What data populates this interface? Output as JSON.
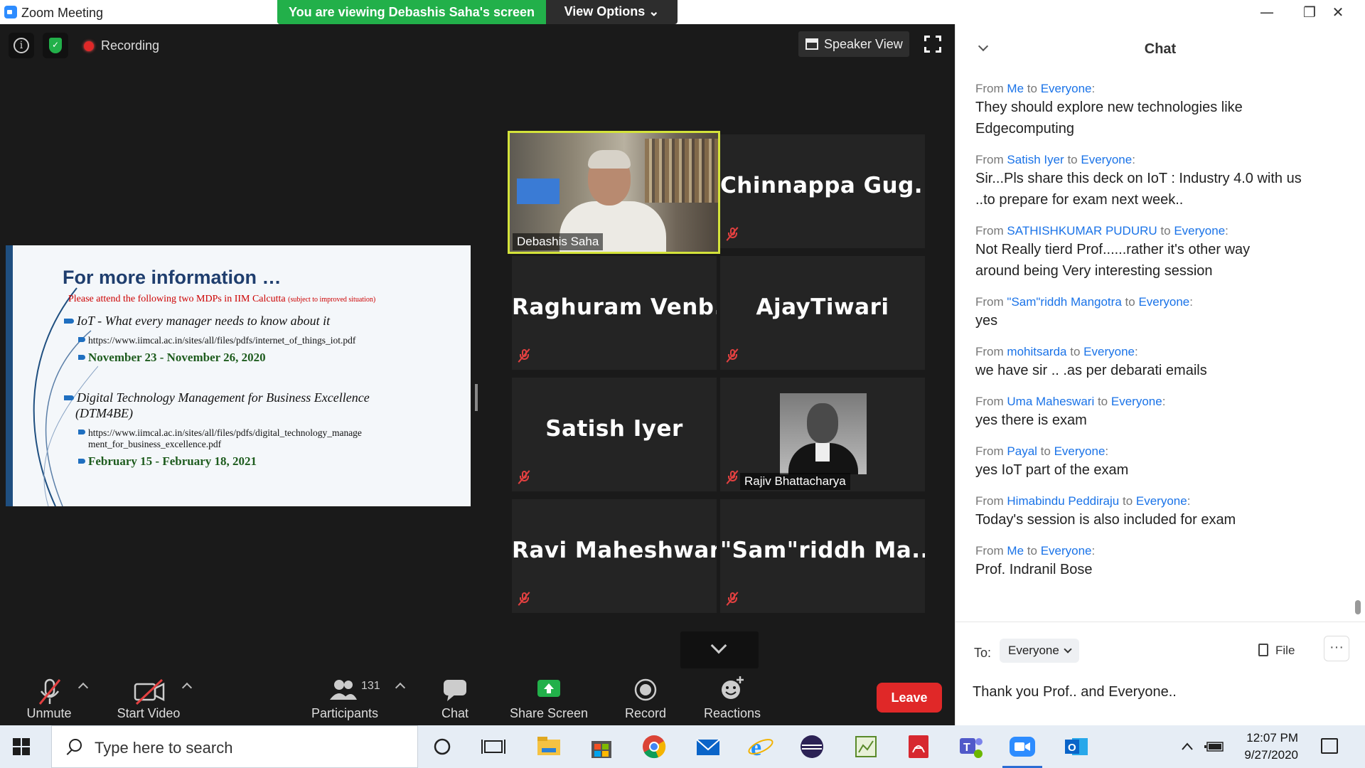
{
  "window": {
    "title": "Zoom Meeting",
    "minimize_glyph": "—",
    "restore_glyph": "❐",
    "close_glyph": "✕"
  },
  "banner": {
    "viewing_text": "You are viewing Debashis Saha's screen",
    "view_options_label": "View Options ⌄"
  },
  "meeting": {
    "recording_label": "Recording",
    "speaker_view_label": "Speaker View"
  },
  "slide": {
    "title": "For more information …",
    "subtitle": "Please attend the following two MDPs in IIM Calcutta",
    "subtitle_note": "(subject to improved situation)",
    "course1_title": "IoT - What every manager needs to know about it",
    "course1_url": "https://www.iimcal.ac.in/sites/all/files/pdfs/internet_of_things_iot.pdf",
    "course1_dates": "November 23 - November 26, 2020",
    "course2_title_line1": "Digital Technology Management for Business Excellence",
    "course2_title_line2": "(DTM4BE)",
    "course2_url_line1": "https://www.iimcal.ac.in/sites/all/files/pdfs/digital_technology_manage",
    "course2_url_line2": "ment_for_business_excellence.pdf",
    "course2_dates": "February 15 - February 18, 2021"
  },
  "participants_grid": [
    {
      "name": "Debashis Saha",
      "display": "video",
      "active": true
    },
    {
      "name": "Chinnappa  Gug...",
      "display": "name",
      "muted": true
    },
    {
      "name": "Raghuram  Venb...",
      "display": "name",
      "muted": true
    },
    {
      "name": "AjayTiwari",
      "display": "name",
      "muted": true
    },
    {
      "name": "Satish Iyer",
      "display": "name",
      "muted": true
    },
    {
      "name": "Rajiv Bhattacharya",
      "display": "photo",
      "muted": true
    },
    {
      "name": "Ravi Maheshwari",
      "display": "name",
      "muted": true
    },
    {
      "name": "\"Sam\"riddh  Ma...",
      "display": "name",
      "muted": true
    }
  ],
  "toolbar": {
    "unmute_label": "Unmute",
    "start_video_label": "Start Video",
    "participants_label": "Participants",
    "participants_count": "131",
    "chat_label": "Chat",
    "share_screen_label": "Share Screen",
    "record_label": "Record",
    "reactions_label": "Reactions",
    "leave_label": "Leave"
  },
  "chat": {
    "title": "Chat",
    "messages": [
      {
        "from": "Me",
        "to": "Everyone",
        "lines": [
          "They should explore new technologies like",
          "Edgecomputing"
        ]
      },
      {
        "from": "Satish Iyer",
        "to": "Everyone",
        "lines": [
          "Sir...Pls share this deck on IoT : Industry 4.0 with us",
          "..to prepare for exam next week.."
        ]
      },
      {
        "from": "SATHISHKUMAR PUDURU",
        "to": "Everyone",
        "lines": [
          "Not Really tierd Prof......rather  it's other way",
          "around being Very interesting session"
        ]
      },
      {
        "from": "\"Sam\"riddh Mangotra",
        "to": "Everyone",
        "lines": [
          "yes"
        ]
      },
      {
        "from": "mohitsarda",
        "to": "Everyone",
        "lines": [
          "we have sir .. .as per debarati emails"
        ]
      },
      {
        "from": "Uma Maheswari",
        "to": "Everyone",
        "lines": [
          "yes there is exam"
        ]
      },
      {
        "from": "Payal",
        "to": "Everyone",
        "lines": [
          "yes IoT part of the exam"
        ]
      },
      {
        "from": "Himabindu Peddiraju",
        "to": "Everyone",
        "lines": [
          "Today's session is also included for exam"
        ]
      },
      {
        "from": "Me",
        "to": "Everyone",
        "lines": [
          "Prof. Indranil Bose"
        ]
      }
    ],
    "from_prefix": "From",
    "to_word": "to",
    "to_label": "To:",
    "recipient": "Everyone",
    "file_label": "File",
    "more_label": "···",
    "input_value": "Thank you Prof.. and Everyone.."
  },
  "taskbar": {
    "search_placeholder": "Type here to search",
    "time": "12:07 PM",
    "date": "9/27/2020"
  },
  "colors": {
    "accent_green": "#22b04a",
    "zoom_blue": "#2d8cff",
    "leave_red": "#e02828",
    "active_speaker_border": "#d4e33a",
    "chat_name_blue": "#1a73e8"
  }
}
